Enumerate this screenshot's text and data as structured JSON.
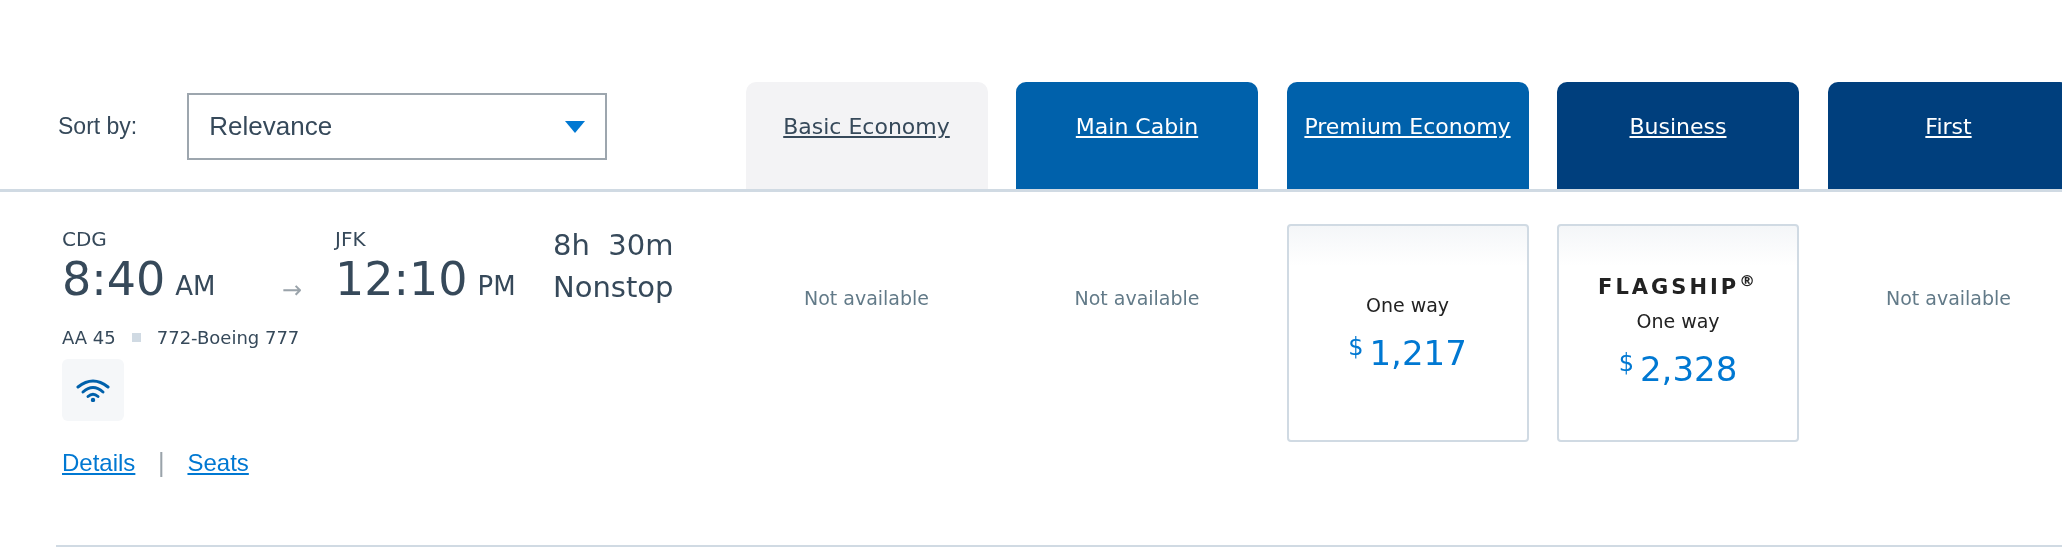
{
  "sort": {
    "label": "Sort by:",
    "value": "Relevance"
  },
  "tabs": [
    {
      "label": "Basic Economy",
      "color": "#f3f3f5"
    },
    {
      "label": "Main Cabin",
      "color": "#0061ab"
    },
    {
      "label": "Premium Economy",
      "color": "#0061ab"
    },
    {
      "label": "Business",
      "color": "#003f7d"
    },
    {
      "label": "First",
      "color": "#003f7d"
    }
  ],
  "flight": {
    "origin": "CDG",
    "depart_time": "8:40",
    "depart_ampm": "AM",
    "destination": "JFK",
    "arrive_time": "12:10",
    "arrive_ampm": "PM",
    "arrow": "→",
    "duration": "8h  30m",
    "stops": "Nonstop",
    "flight_number": "AA 45",
    "aircraft": "772-Boeing 777",
    "wifi": true,
    "links": [
      "Details",
      "Seats"
    ],
    "link_separator": "|"
  },
  "fares": [
    {
      "kind": "unavailable",
      "text": "Not available"
    },
    {
      "kind": "unavailable",
      "text": "Not available"
    },
    {
      "kind": "fare",
      "label": "One way",
      "currency": "$",
      "price": "1,217"
    },
    {
      "kind": "fare",
      "brand": "FLAGSHIP$^{®}$",
      "label": "One way",
      "currency": "$",
      "price": "2,328"
    },
    {
      "kind": "unavailable",
      "text": "Not available"
    }
  ]
}
